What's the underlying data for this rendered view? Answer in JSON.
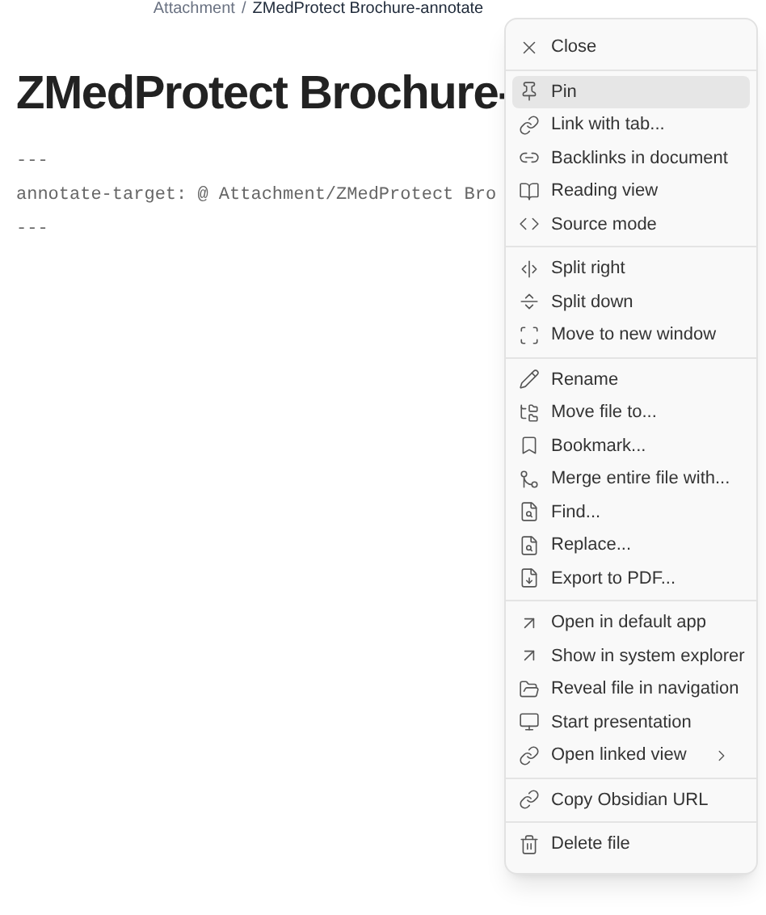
{
  "breadcrumb": [
    "Attachment",
    "/",
    "ZMedProtect Brochure-annotate"
  ],
  "note": {
    "title": "ZMedProtect Brochure-",
    "lines": [
      "---",
      "annotate-target: @ Attachment/ZMedProtect Bro",
      "---"
    ]
  },
  "menu": {
    "sections": [
      [
        {
          "label": "Close",
          "selected": false,
          "submenu": false
        }
      ],
      [
        {
          "label": "Pin",
          "selected": true,
          "submenu": false
        },
        {
          "label": "Link with tab...",
          "selected": false,
          "submenu": false
        },
        {
          "label": "Backlinks in document",
          "selected": false,
          "submenu": false
        },
        {
          "label": "Reading view",
          "selected": false,
          "submenu": false
        },
        {
          "label": "Source mode",
          "selected": false,
          "submenu": false
        }
      ],
      [
        {
          "label": "Split right",
          "selected": false,
          "submenu": false
        },
        {
          "label": "Split down",
          "selected": false,
          "submenu": false
        },
        {
          "label": "Move to new window",
          "selected": false,
          "submenu": false
        }
      ],
      [
        {
          "label": "Rename",
          "selected": false,
          "submenu": false
        },
        {
          "label": "Move file to...",
          "selected": false,
          "submenu": false
        },
        {
          "label": "Bookmark...",
          "selected": false,
          "submenu": false
        },
        {
          "label": "Merge entire file with...",
          "selected": false,
          "submenu": false
        },
        {
          "label": "Find...",
          "selected": false,
          "submenu": false
        },
        {
          "label": "Replace...",
          "selected": false,
          "submenu": false
        },
        {
          "label": "Export to PDF...",
          "selected": false,
          "submenu": false
        }
      ],
      [
        {
          "label": "Open in default app",
          "selected": false,
          "submenu": false
        },
        {
          "label": "Show in system explorer",
          "selected": false,
          "submenu": false
        },
        {
          "label": "Reveal file in navigation",
          "selected": false,
          "submenu": false
        },
        {
          "label": "Start presentation",
          "selected": false,
          "submenu": false
        },
        {
          "label": "Open linked view",
          "selected": false,
          "submenu": true
        }
      ],
      [
        {
          "label": "Copy Obsidian URL",
          "selected": false,
          "submenu": false
        }
      ],
      [
        {
          "label": "Delete file",
          "selected": false,
          "submenu": false
        }
      ]
    ]
  }
}
